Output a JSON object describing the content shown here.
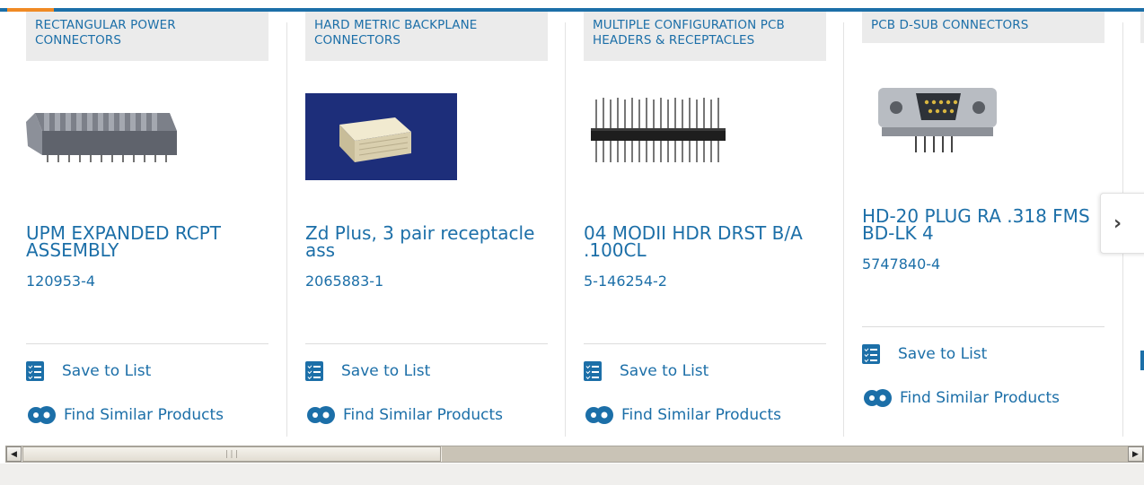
{
  "cards": [
    {
      "category": "RECTANGULAR POWER CONNECTORS",
      "title": "UPM EXPANDED RCPT ASSEMBLY",
      "part_number": "120953-4",
      "save_label": "Save to List",
      "similar_label": "Find Similar Products"
    },
    {
      "category": "HARD METRIC BACKPLANE CONNECTORS",
      "title": "Zd Plus, 3 pair receptacle ass",
      "part_number": "2065883-1",
      "save_label": "Save to List",
      "similar_label": "Find Similar Products"
    },
    {
      "category": "MULTIPLE CONFIGURATION PCB HEADERS & RECEPTACLES",
      "title": "04 MODII HDR DRST B/A .100CL",
      "part_number": "5-146254-2",
      "save_label": "Save to List",
      "similar_label": "Find Similar Products"
    },
    {
      "category": "PCB D-SUB CONNECTORS",
      "title": "HD-20 PLUG RA .318 FMS BD-LK 4",
      "part_number": "5747840-4",
      "save_label": "Save to List",
      "similar_label": "Find Similar Products"
    }
  ],
  "next_button": {
    "icon": "chevron-right-icon",
    "glyph": "›"
  },
  "scrollbar": {
    "grip": "|||"
  },
  "colors": {
    "link": "#1c6fa8",
    "accent_orange": "#f08a24",
    "brand_blue": "#1c6fa8"
  }
}
